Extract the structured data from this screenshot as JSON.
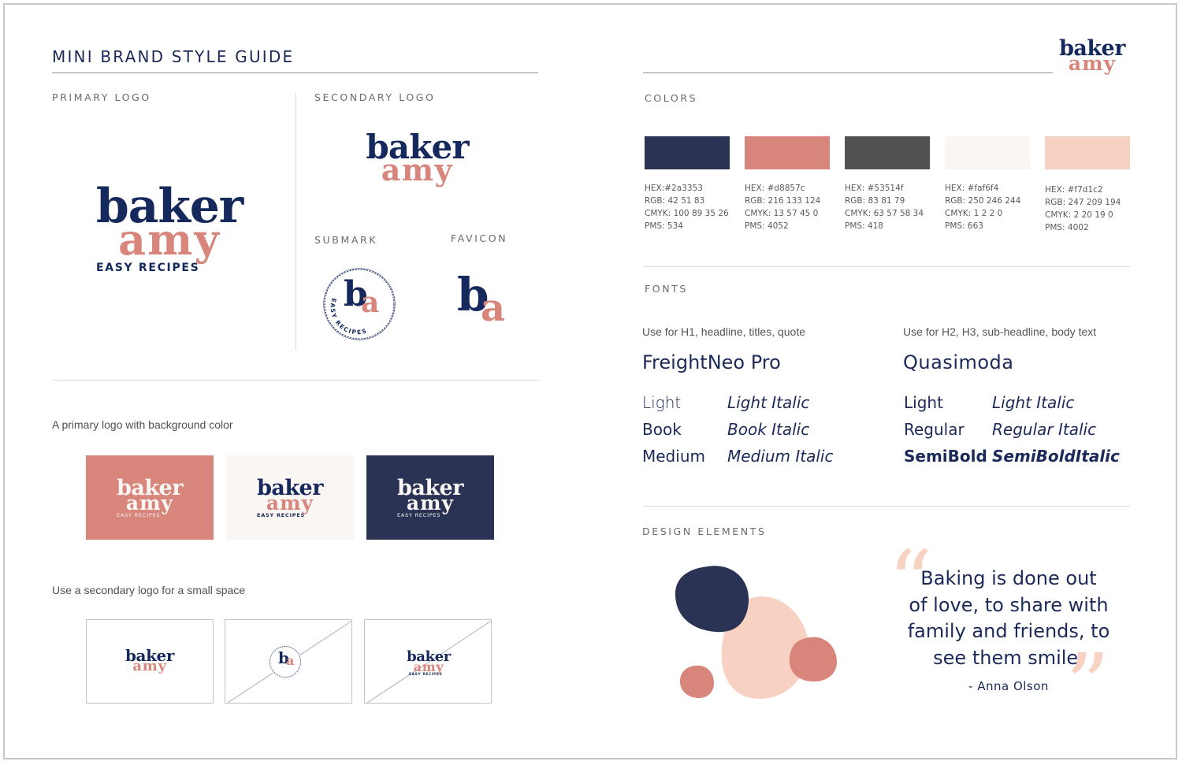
{
  "header": {
    "title": "MINI BRAND STYLE GUIDE"
  },
  "brand": {
    "word1": "baker",
    "word2": "amy",
    "tagline": "EASY RECIPES",
    "mark_b": "b",
    "mark_a": "a",
    "colors": {
      "navy": "#2a3353",
      "pink": "#d8857c",
      "charcoal": "#53514f",
      "offwhite": "#faf6f4",
      "blush": "#f7d1c2",
      "logo_navy": "#16295c"
    }
  },
  "left": {
    "primary_logo_label": "PRIMARY LOGO",
    "secondary_logo_label": "SECONDARY LOGO",
    "submark_label": "SUBMARK",
    "favicon_label": "FAVICON",
    "submark_ring_text": "EASY RECIPES",
    "bg_caption": "A primary logo with background color",
    "small_caption": "Use a secondary logo for a small space"
  },
  "colors_section": {
    "label": "COLORS",
    "swatches": [
      {
        "hex_label": "HEX:#2a3353",
        "rgb": "RGB: 42 51 83",
        "cmyk": "CMYK: 100 89 35 26",
        "pms": "PMS: 534",
        "color": "#2a3353"
      },
      {
        "hex_label": "HEX: #d8857c",
        "rgb": "RGB: 216 133 124",
        "cmyk": "CMYK: 13 57 45 0",
        "pms": "PMS: 4052",
        "color": "#d8857c"
      },
      {
        "hex_label": "HEX: #53514f",
        "rgb": "RGB: 83 81 79",
        "cmyk": "CMYK: 63 57 58 34",
        "pms": "PMS: 418",
        "color": "#53514f"
      },
      {
        "hex_label": "HEX: #faf6f4",
        "rgb": "RGB: 250 246 244",
        "cmyk": "CMYK: 1 2 2 0",
        "pms": "PMS: 663",
        "color": "#faf6f4"
      },
      {
        "hex_label": "HEX: #f7d1c2",
        "rgb": "RGB: 247 209 194",
        "cmyk": "CMYK: 2 20 19 0",
        "pms": "PMS: 4002",
        "color": "#f7d1c2"
      }
    ]
  },
  "fonts_section": {
    "label": "FONTS",
    "fonts": [
      {
        "usage": "Use for H1, headline, titles, quote",
        "name": "FreightNeo Pro",
        "weights": [
          [
            "Light",
            "Light Italic"
          ],
          [
            "Book",
            "Book Italic"
          ],
          [
            "Medium",
            "Medium Italic"
          ]
        ]
      },
      {
        "usage": "Use for H2, H3, sub-headline, body text",
        "name": "Quasimoda",
        "weights": [
          [
            "Light",
            "Light Italic"
          ],
          [
            "Regular",
            "Regular Italic"
          ],
          [
            "SemiBold",
            "SemiBoldItalic"
          ]
        ]
      }
    ]
  },
  "design_section": {
    "label": "DESIGN ELEMENTS",
    "quote_lines": [
      "Baking is done out",
      "of love, to share with",
      "family and friends, to",
      "see them smile."
    ],
    "open_quote": "“",
    "close_quote": "”",
    "attribution": "- Anna Olson"
  }
}
